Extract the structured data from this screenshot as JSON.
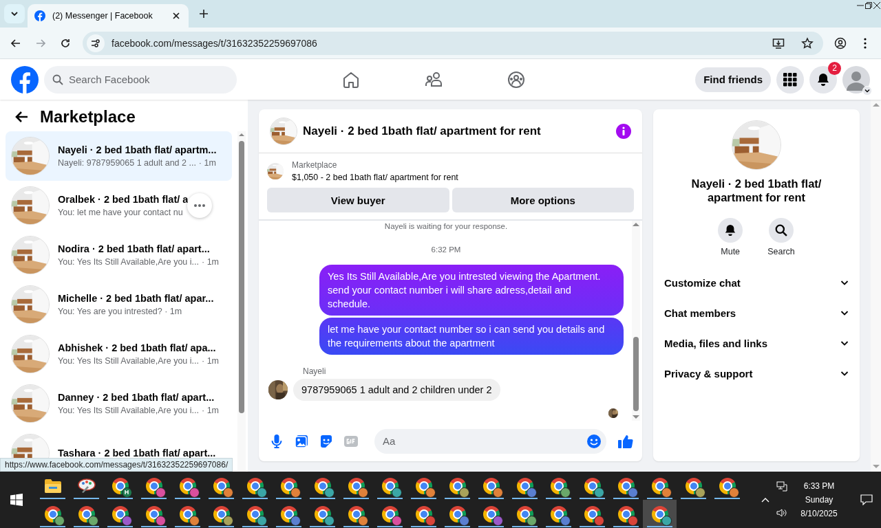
{
  "browser": {
    "tab_title": "(2) Messenger | Facebook",
    "url": "facebook.com/messages/t/31632352259697086",
    "status_url": "https://www.facebook.com/messages/t/31632352259697086/"
  },
  "header": {
    "search_placeholder": "Search Facebook",
    "find_friends": "Find friends",
    "notifications_count": "2"
  },
  "sidebar": {
    "title": "Marketplace",
    "conversations": [
      {
        "name": "Nayeli · 2 bed 1bath flat/ apartm...",
        "preview": "Nayeli: 9787959065 1 adult and 2 ...",
        "time": "· 1m",
        "selected": true,
        "more_button": false
      },
      {
        "name": "Oralbek · 2 bed 1bath flat/ a",
        "preview": "You: let me have your contact nu",
        "selected": false,
        "more_button": true
      },
      {
        "name": "Nodira · 2 bed 1bath flat/ apart...",
        "preview": "You: Yes Its Still Available,Are you i...",
        "time": "· 1m",
        "selected": false,
        "more_button": false
      },
      {
        "name": "Michelle · 2 bed 1bath flat/ apar...",
        "preview": "You: Yes are you intrested? · 1m",
        "selected": false,
        "more_button": false
      },
      {
        "name": "Abhishek · 2 bed 1bath flat/ apa...",
        "preview": "You: Yes Its Still Available,Are you i...",
        "time": "· 1m",
        "selected": false,
        "more_button": false
      },
      {
        "name": "Danney · 2 bed 1bath flat/ apart...",
        "preview": "You: Yes Its Still Available,Are you i...",
        "time": "· 1m",
        "selected": false,
        "more_button": false
      },
      {
        "name": "Tashara · 2 bed 1bath flat/ apart...",
        "selected": false,
        "more_button": false
      }
    ]
  },
  "chat": {
    "title": "Nayeli · 2 bed 1bath flat/ apartment for rent",
    "listing": {
      "label": "Marketplace",
      "title": "$1,050 - 2 bed 1bath flat/ apartment for rent"
    },
    "buttons": [
      "View buyer",
      "More options"
    ],
    "messages": [
      {
        "kind": "system",
        "text": "Nayeli is waiting for your response."
      },
      {
        "kind": "time",
        "text": "6:32 PM"
      },
      {
        "kind": "outgoing",
        "text": "Yes Its Still Available,Are you intrested viewing the Apartment. send your contact number i will share adress,detail and schedule."
      },
      {
        "kind": "outgoing",
        "text": "let me have your contact number so i can send you details and the requirements about the apartment"
      },
      {
        "kind": "incoming",
        "sender": "Nayeli",
        "text": "9787959065 1 adult and 2 children under 2"
      }
    ],
    "composer_placeholder": "Aa"
  },
  "details": {
    "title": "Nayeli · 2 bed 1bath flat/ apartment for rent",
    "actions": [
      {
        "kind": "mute",
        "label": "Mute"
      },
      {
        "kind": "search",
        "label": "Search"
      }
    ],
    "sections": [
      {
        "label": "Customize chat",
        "expanded": false
      },
      {
        "label": "Chat members",
        "expanded": false
      },
      {
        "label": "Media, files and links",
        "expanded": false
      },
      {
        "label": "Privacy & support",
        "expanded": false
      }
    ]
  },
  "taskbar": {
    "rows": [
      [
        {
          "kind": "folder",
          "active": false
        },
        {
          "kind": "paint",
          "active": false
        },
        {
          "kind": "browser",
          "color": "#1e7a4f",
          "letter": "H",
          "active": false
        },
        {
          "kind": "browser",
          "color": "#d94f9e",
          "active": false
        },
        {
          "kind": "browser",
          "color": "#d94f9e",
          "active": false
        },
        {
          "kind": "browser",
          "color": "#e0813a",
          "active": false
        },
        {
          "kind": "browser",
          "color": "#3aa6a6",
          "active": false
        },
        {
          "kind": "browser",
          "color": "#e0813a",
          "active": false
        },
        {
          "kind": "browser",
          "color": "#3aa6a6",
          "active": false
        },
        {
          "kind": "browser",
          "color": "#e0813a",
          "active": false
        },
        {
          "kind": "browser",
          "color": "#3aa6a6",
          "active": false
        },
        {
          "kind": "browser",
          "color": "#e0813a",
          "active": false
        },
        {
          "kind": "browser",
          "color": "#a8a25a",
          "active": false
        },
        {
          "kind": "browser",
          "color": "#e0813a",
          "active": false
        },
        {
          "kind": "browser",
          "color": "#5a7fd0",
          "active": false
        },
        {
          "kind": "browser",
          "color": "#6aa86a",
          "active": false
        },
        {
          "kind": "browser",
          "color": "#3aa6a6",
          "active": false
        },
        {
          "kind": "browser",
          "color": "#5a7fd0",
          "active": false
        },
        {
          "kind": "browser",
          "color": "#e0813a",
          "active": false
        },
        {
          "kind": "browser",
          "color": "#a8a25a",
          "active": false
        },
        {
          "kind": "browser",
          "color": "#e0813a",
          "active": false
        }
      ],
      [
        {
          "kind": "browser",
          "color": "#6aa86a",
          "active": false
        },
        {
          "kind": "browser",
          "color": "#6aa86a",
          "active": false
        },
        {
          "kind": "browser",
          "color": "#9b59c9",
          "active": false
        },
        {
          "kind": "browser",
          "color": "#d94f9e",
          "active": false
        },
        {
          "kind": "browser",
          "color": "#e0813a",
          "active": false
        },
        {
          "kind": "browser",
          "color": "#a8a25a",
          "active": false
        },
        {
          "kind": "browser",
          "color": "#3aa6a6",
          "active": false
        },
        {
          "kind": "browser",
          "color": "#5a7fd0",
          "active": false
        },
        {
          "kind": "browser",
          "color": "#3aa6a6",
          "active": false
        },
        {
          "kind": "browser",
          "color": "#e0813a",
          "active": false
        },
        {
          "kind": "browser",
          "color": "#d94f9e",
          "active": false
        },
        {
          "kind": "browser",
          "color": "#d9443a",
          "active": false
        },
        {
          "kind": "browser",
          "color": "#5a7fd0",
          "active": false
        },
        {
          "kind": "browser",
          "color": "#9b59c9",
          "active": false
        },
        {
          "kind": "browser",
          "color": "#6aa86a",
          "active": false
        },
        {
          "kind": "browser",
          "color": "#5a7fd0",
          "active": false
        },
        {
          "kind": "browser",
          "color": "#d9443a",
          "active": false
        },
        {
          "kind": "browser",
          "color": "#d9443a",
          "active": false
        },
        {
          "kind": "browser",
          "color": "#3aa6a6",
          "active": true
        }
      ]
    ],
    "time": "6:33 PM",
    "day": "Sunday",
    "date": "8/10/2025"
  }
}
